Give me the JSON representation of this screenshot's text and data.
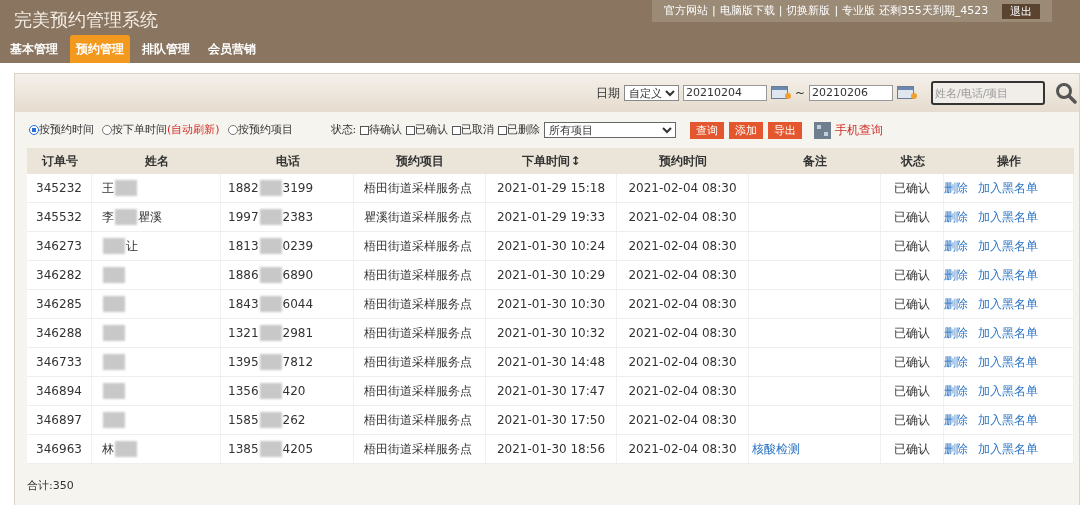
{
  "header": {
    "title": "完美预约管理系统",
    "links": [
      "官方网站",
      "电脑版下载",
      "切换新版"
    ],
    "link_separator": "|",
    "account": "专业版 还剩355天到期_4523",
    "logout": "退出"
  },
  "nav": [
    {
      "label": "基本管理",
      "selected": false
    },
    {
      "label": "预约管理",
      "selected": true
    },
    {
      "label": "排队管理",
      "selected": false
    },
    {
      "label": "会员营销",
      "selected": false
    }
  ],
  "date_filter": {
    "label": "日期",
    "mode": "自定义",
    "from": "20210204",
    "separator": "~",
    "to": "20210206",
    "search_placeholder": "姓名/电话/项目"
  },
  "sort_options": [
    {
      "label": "按预约时间",
      "selected": true
    },
    {
      "label": "按下单时间",
      "selected": false,
      "note": "(自动刷新)"
    },
    {
      "label": "按预约项目",
      "selected": false
    }
  ],
  "status_filter": {
    "label": "状态:",
    "options": [
      {
        "label": "待确认",
        "checked": false
      },
      {
        "label": "已确认",
        "checked": false
      },
      {
        "label": "已取消",
        "checked": false
      },
      {
        "label": "已删除",
        "checked": false
      }
    ],
    "project": "所有项目"
  },
  "actions": [
    "查询",
    "添加",
    "导出"
  ],
  "mobile_query": "手机查询",
  "table": {
    "columns": [
      "订单号",
      "姓名",
      "电话",
      "预约项目",
      "下单时间↕",
      "预约时间",
      "备注",
      "状态",
      "操作"
    ],
    "rows": [
      {
        "id": "345232",
        "name_start": "王",
        "phone_start": "1882",
        "phone_end": "3199",
        "project": "梧田街道采样服务点",
        "ordered": "2021-01-29 15:18",
        "booked": "2021-02-04 08:30",
        "status": "已确认",
        "ops": [
          "删除",
          "加入黑名单"
        ]
      },
      {
        "id": "345532",
        "name_start": "李",
        "name_end": "瞿溪",
        "phone_start": "1997",
        "phone_end": "2383",
        "project": "瞿溪街道采样服务点",
        "ordered": "2021-01-29 19:33",
        "booked": "2021-02-04 08:30",
        "status": "已确认",
        "ops": [
          "删除",
          "加入黑名单"
        ]
      },
      {
        "id": "346273",
        "name_end": "让",
        "phone_start": "1813",
        "phone_end": "0239",
        "project": "梧田街道采样服务点",
        "ordered": "2021-01-30 10:24",
        "booked": "2021-02-04 08:30",
        "status": "已确认",
        "ops": [
          "删除",
          "加入黑名单"
        ]
      },
      {
        "id": "346282",
        "phone_start": "1886",
        "phone_end": "6890",
        "project": "梧田街道采样服务点",
        "ordered": "2021-01-30 10:29",
        "booked": "2021-02-04 08:30",
        "status": "已确认",
        "ops": [
          "删除",
          "加入黑名单"
        ]
      },
      {
        "id": "346285",
        "phone_start": "1843",
        "phone_end": "6044",
        "project": "梧田街道采样服务点",
        "ordered": "2021-01-30 10:30",
        "booked": "2021-02-04 08:30",
        "status": "已确认",
        "ops": [
          "删除",
          "加入黑名单"
        ]
      },
      {
        "id": "346288",
        "phone_start": "1321",
        "phone_end": "2981",
        "project": "梧田街道采样服务点",
        "ordered": "2021-01-30 10:32",
        "booked": "2021-02-04 08:30",
        "status": "已确认",
        "ops": [
          "删除",
          "加入黑名单"
        ]
      },
      {
        "id": "346733",
        "phone_start": "1395",
        "phone_end": "7812",
        "project": "梧田街道采样服务点",
        "ordered": "2021-01-30 14:48",
        "booked": "2021-02-04 08:30",
        "status": "已确认",
        "ops": [
          "删除",
          "加入黑名单"
        ]
      },
      {
        "id": "346894",
        "phone_start": "1356",
        "phone_end": "420",
        "project": "梧田街道采样服务点",
        "ordered": "2021-01-30 17:47",
        "booked": "2021-02-04 08:30",
        "status": "已确认",
        "ops": [
          "删除",
          "加入黑名单"
        ]
      },
      {
        "id": "346897",
        "phone_start": "1585",
        "phone_end": "262",
        "project": "梧田街道采样服务点",
        "ordered": "2021-01-30 17:50",
        "booked": "2021-02-04 08:30",
        "status": "已确认",
        "ops": [
          "删除",
          "加入黑名单"
        ]
      },
      {
        "id": "346963",
        "name_start": "林",
        "phone_start": "1385",
        "phone_end": "4205",
        "project": "梧田街道采样服务点",
        "ordered": "2021-01-30 18:56",
        "booked": "2021-02-04 08:30",
        "note": "核酸检测",
        "status": "已确认",
        "ops": [
          "删除",
          "加入黑名单"
        ]
      }
    ]
  },
  "total": "合计:350"
}
